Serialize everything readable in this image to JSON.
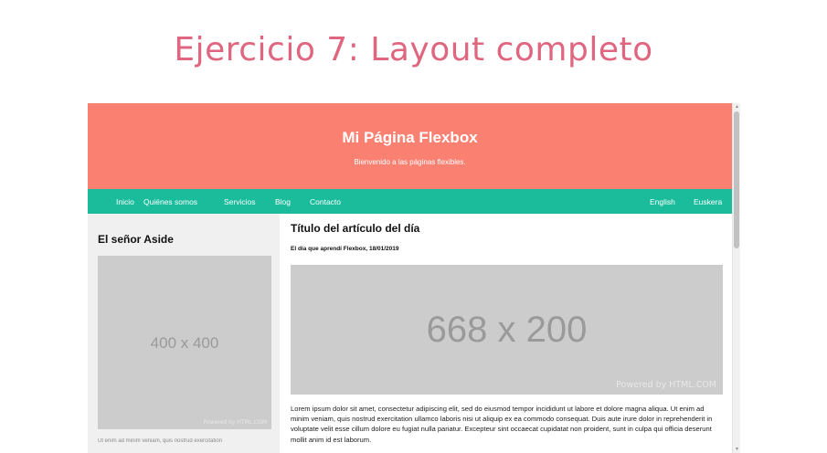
{
  "slide": {
    "title": "Ejercicio 7: Layout completo"
  },
  "header": {
    "title": "Mi Página Flexbox",
    "subtitle": "Bienvenido a las páginas flexibles."
  },
  "nav": {
    "left": [
      "Inicio",
      "Quiénes somos",
      "Servicios",
      "Blog",
      "Contacto"
    ],
    "right": [
      "English",
      "Euskera"
    ]
  },
  "aside": {
    "title": "El señor Aside",
    "image_label": "400 x 400",
    "image_powered": "Powered by HTML.COM",
    "paragraph_start": "Ut enim ad minim veniam, quis nostrud exercitation"
  },
  "article": {
    "title": "Título del artículo del día",
    "date": "El día que aprendí Flexbox, 18/01/2019",
    "image_label": "668 x 200",
    "image_powered": "Powered by HTML.COM",
    "body": "Lorem ipsum dolor sit amet, consectetur adipiscing elit, sed do eiusmod tempor incididunt ut labore et dolore magna aliqua. Ut enim ad minim veniam, quis nostrud exercitation ullamco laboris nisi ut aliquip ex ea commodo consequat. Duis aute irure dolor in reprehenderit in voluptate velit esse cillum dolore eu fugiat nulla pariatur. Excepteur sint occaecat cupidatat non proident, sunt in culpa qui officia deserunt mollit anim id est laborum."
  },
  "scrollbar": {
    "up_icon": "scroll-up-icon",
    "down_icon": "scroll-down-icon"
  },
  "colors": {
    "slide_title": "#e06680",
    "header_bg": "#fa8072",
    "nav_bg": "#1abc9c",
    "aside_bg": "#f0f0f0",
    "placeholder_bg": "#cccccc"
  }
}
